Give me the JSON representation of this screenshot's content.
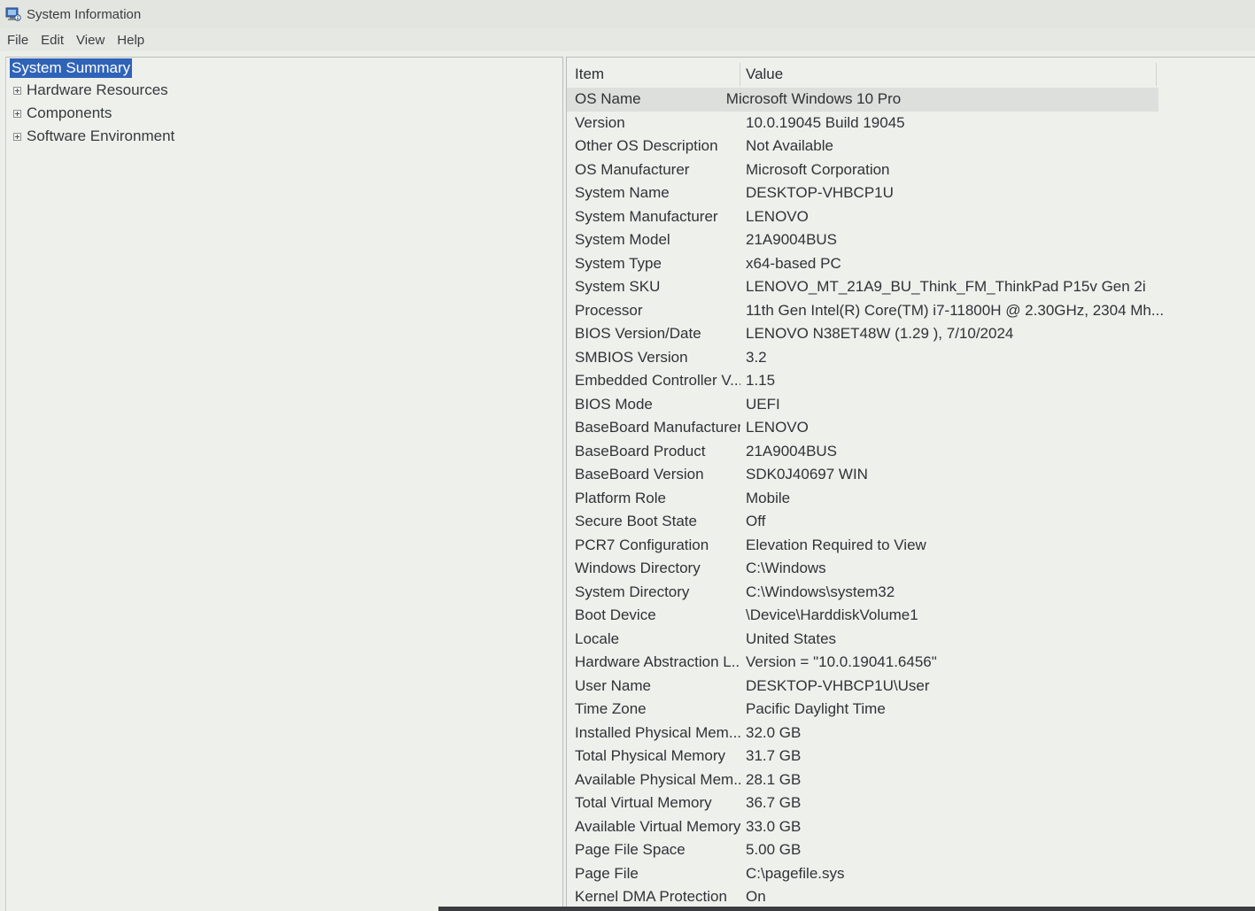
{
  "window": {
    "title": "System Information",
    "icon": "system-information-icon"
  },
  "menu": {
    "file": "File",
    "edit": "Edit",
    "view": "View",
    "help": "Help"
  },
  "tree": {
    "items": [
      {
        "label": "System Summary",
        "selected": true,
        "expandable": false
      },
      {
        "label": "Hardware Resources",
        "selected": false,
        "expandable": true
      },
      {
        "label": "Components",
        "selected": false,
        "expandable": true
      },
      {
        "label": "Software Environment",
        "selected": false,
        "expandable": true
      }
    ]
  },
  "table": {
    "headers": {
      "item": "Item",
      "value": "Value"
    },
    "rows": [
      {
        "item": "OS Name",
        "value": "Microsoft Windows 10 Pro"
      },
      {
        "item": "Version",
        "value": "10.0.19045 Build 19045"
      },
      {
        "item": "Other OS Description",
        "value": "Not Available"
      },
      {
        "item": "OS Manufacturer",
        "value": "Microsoft Corporation"
      },
      {
        "item": "System Name",
        "value": "DESKTOP-VHBCP1U"
      },
      {
        "item": "System Manufacturer",
        "value": "LENOVO"
      },
      {
        "item": "System Model",
        "value": "21A9004BUS"
      },
      {
        "item": "System Type",
        "value": "x64-based PC"
      },
      {
        "item": "System SKU",
        "value": "LENOVO_MT_21A9_BU_Think_FM_ThinkPad P15v Gen 2i"
      },
      {
        "item": "Processor",
        "value": "11th Gen Intel(R) Core(TM) i7-11800H @ 2.30GHz, 2304 Mh..."
      },
      {
        "item": "BIOS Version/Date",
        "value": "LENOVO N38ET48W (1.29 ), 7/10/2024"
      },
      {
        "item": "SMBIOS Version",
        "value": "3.2"
      },
      {
        "item": "Embedded Controller V...",
        "value": "1.15"
      },
      {
        "item": "BIOS Mode",
        "value": "UEFI"
      },
      {
        "item": "BaseBoard Manufacturer",
        "value": "LENOVO"
      },
      {
        "item": "BaseBoard Product",
        "value": "21A9004BUS"
      },
      {
        "item": "BaseBoard Version",
        "value": "SDK0J40697 WIN"
      },
      {
        "item": "Platform Role",
        "value": "Mobile"
      },
      {
        "item": "Secure Boot State",
        "value": "Off"
      },
      {
        "item": "PCR7 Configuration",
        "value": "Elevation Required to View"
      },
      {
        "item": "Windows Directory",
        "value": "C:\\Windows"
      },
      {
        "item": "System Directory",
        "value": "C:\\Windows\\system32"
      },
      {
        "item": "Boot Device",
        "value": "\\Device\\HarddiskVolume1"
      },
      {
        "item": "Locale",
        "value": "United States"
      },
      {
        "item": "Hardware Abstraction L...",
        "value": "Version = \"10.0.19041.6456\""
      },
      {
        "item": "User Name",
        "value": "DESKTOP-VHBCP1U\\User"
      },
      {
        "item": "Time Zone",
        "value": "Pacific Daylight Time"
      },
      {
        "item": "Installed Physical Mem...",
        "value": "32.0 GB"
      },
      {
        "item": "Total Physical Memory",
        "value": "31.7 GB"
      },
      {
        "item": "Available Physical Mem...",
        "value": "28.1 GB"
      },
      {
        "item": "Total Virtual Memory",
        "value": "36.7 GB"
      },
      {
        "item": "Available Virtual Memory",
        "value": "33.0 GB"
      },
      {
        "item": "Page File Space",
        "value": "5.00 GB"
      },
      {
        "item": "Page File",
        "value": "C:\\pagefile.sys"
      },
      {
        "item": "Kernel DMA Protection",
        "value": "On"
      }
    ]
  },
  "colors": {
    "selection": "#2f63b8",
    "background": "#eef0ec"
  }
}
